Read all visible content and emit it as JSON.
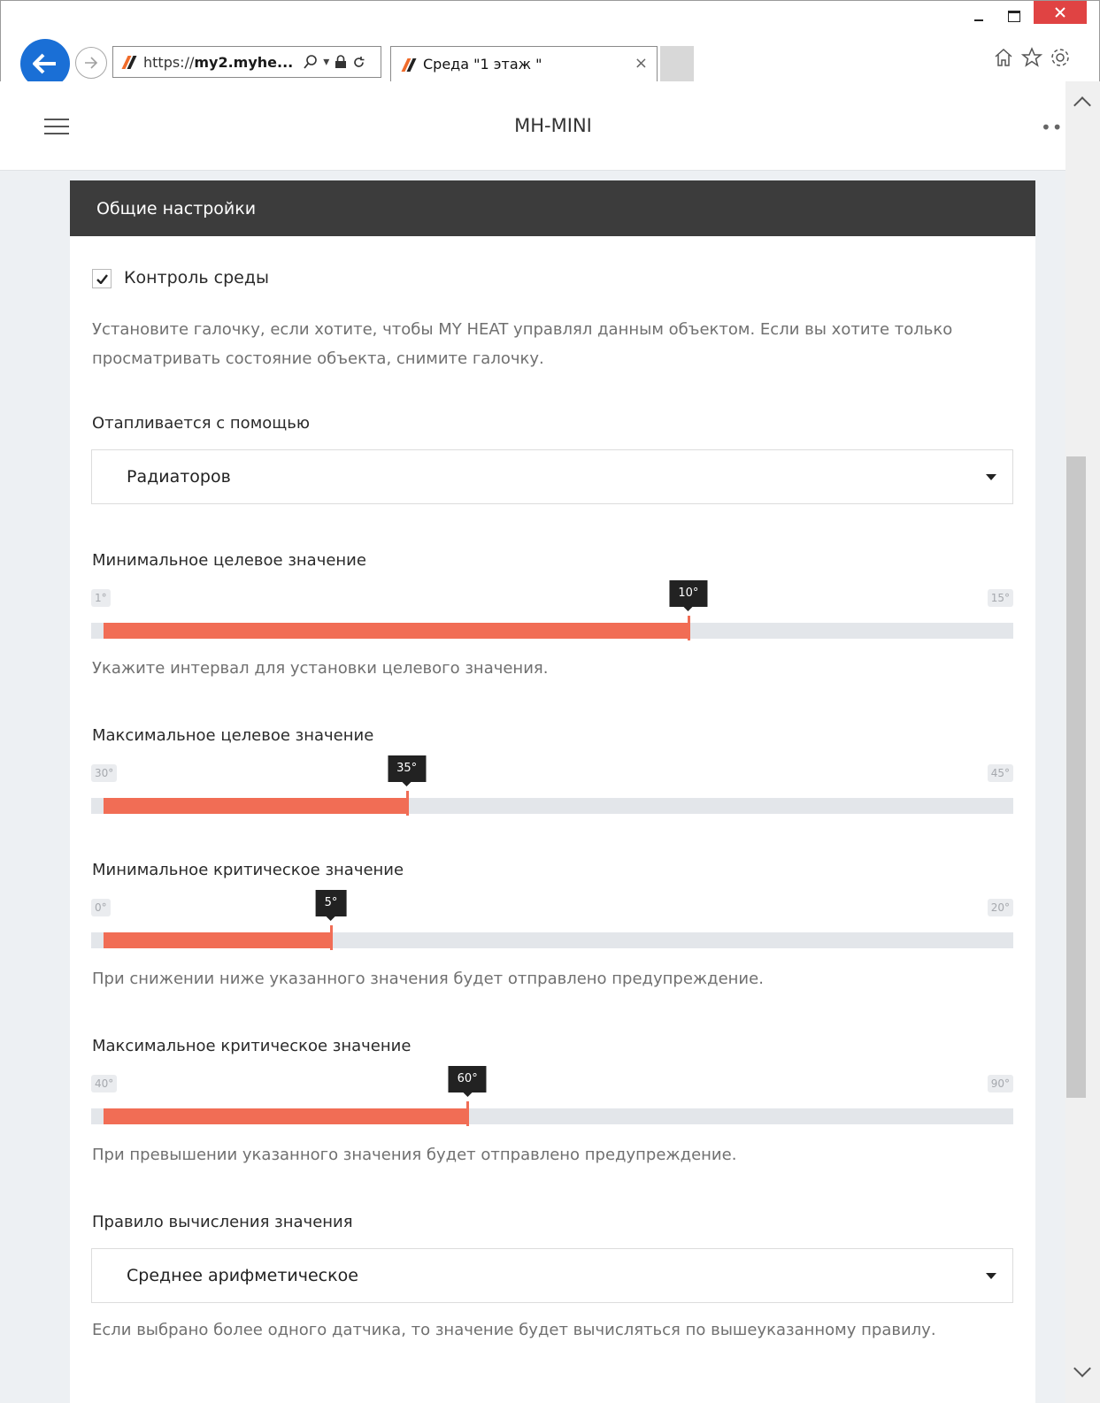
{
  "browser": {
    "url_prefix": "https://",
    "url_domain": "my2.myhe...",
    "tab_title": "Среда \"1 этаж \"",
    "window_controls": [
      "_",
      "□",
      "×"
    ]
  },
  "app": {
    "title": "MH-MINI"
  },
  "section": {
    "title": "Общие настройки"
  },
  "control": {
    "checkbox_label": "Контроль среды",
    "checked": true,
    "help": "Установите галочку, если хотите, чтобы MY HEAT управлял данным объектом. Если вы хотите только просматривать состояние объекта, снимите галочку."
  },
  "heating": {
    "label": "Отапливается с помощью",
    "value": "Радиаторов"
  },
  "sliders": [
    {
      "label": "Минимальное целевое значение",
      "min_label": "1°",
      "max_label": "15°",
      "value_label": "10°",
      "min": 1,
      "max": 15,
      "value": 10,
      "help": "Укажите интервал для установки целевого значения."
    },
    {
      "label": "Максимальное целевое значение",
      "min_label": "30°",
      "max_label": "45°",
      "value_label": "35°",
      "min": 30,
      "max": 45,
      "value": 35,
      "help": ""
    },
    {
      "label": "Минимальное критическое значение",
      "min_label": "0°",
      "max_label": "20°",
      "value_label": "5°",
      "min": 0,
      "max": 20,
      "value": 5,
      "help": "При снижении ниже указанного значения будет отправлено предупреждение."
    },
    {
      "label": "Максимальное критическое значение",
      "min_label": "40°",
      "max_label": "90°",
      "value_label": "60°",
      "min": 40,
      "max": 90,
      "value": 60,
      "help": "При превышении указанного значения будет отправлено предупреждение."
    }
  ],
  "calc_rule": {
    "label": "Правило вычисления значения",
    "value": "Среднее арифметическое",
    "help": "Если выбрано более одного датчика, то значение будет вычисляться по вышеуказанному правилу."
  },
  "colors": {
    "accent": "#f16d55",
    "header_bg": "#3c3c3c",
    "browser_back": "#1a6fd6"
  }
}
